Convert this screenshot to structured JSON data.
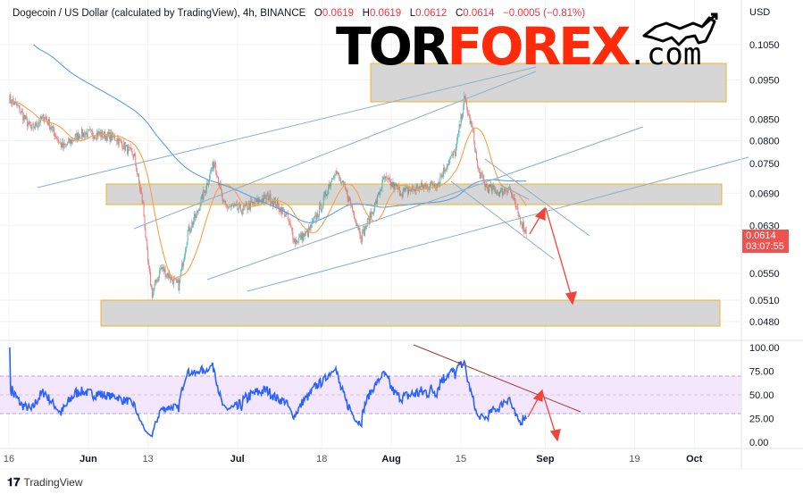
{
  "header": {
    "symbol": "Dogecoin / US Dollar (calculated by TradingView), 4h, BINANCE",
    "o_label": "O",
    "o_value": "0.0619",
    "h_label": "H",
    "h_value": "0.0619",
    "l_label": "L",
    "l_value": "0.0612",
    "c_label": "C",
    "c_value": "0.0614",
    "change": "−0.0005 (−0.81%)"
  },
  "watermark": {
    "part1": "TOR",
    "part2": "FOREX",
    "part3": ".com"
  },
  "price_tag": {
    "price": "0.0614",
    "countdown": "03:07:55"
  },
  "footer": {
    "brand": "TradingView"
  },
  "colors": {
    "up": "#26a69a",
    "down": "#ef5350",
    "ma_fast": "#f7a24a",
    "ma_slow": "#5b9cf0",
    "rsi": "#2962ff",
    "zone_border": "#f0b429",
    "arrow": "#f0443a",
    "accent_red": "#ff2a0a"
  },
  "chart_data": {
    "type": "candlestick",
    "title": "Dogecoin / US Dollar, 4h, BINANCE",
    "currency_label": "USD",
    "y_scale": "log",
    "ylim": [
      0.0455,
      0.112
    ],
    "y_ticks": [
      "0.1050",
      "0.0950",
      "0.0850",
      "0.0800",
      "0.0750",
      "0.0690",
      "0.0630",
      "0.0550",
      "0.0510",
      "0.0480"
    ],
    "x_ticks": [
      {
        "label": "16",
        "day": 0,
        "bold": false
      },
      {
        "label": "Jun",
        "day": 16,
        "bold": true
      },
      {
        "label": "13",
        "day": 28,
        "bold": false
      },
      {
        "label": "Jul",
        "day": 46,
        "bold": true
      },
      {
        "label": "18",
        "day": 63,
        "bold": false
      },
      {
        "label": "Aug",
        "day": 77,
        "bold": true
      },
      {
        "label": "15",
        "day": 91,
        "bold": false
      },
      {
        "label": "Sep",
        "day": 108,
        "bold": true
      },
      {
        "label": "19",
        "day": 126,
        "bold": false
      },
      {
        "label": "Oct",
        "day": 138,
        "bold": true
      }
    ],
    "x_unit": "days since May 16",
    "close_path": [
      [
        0,
        0.0902
      ],
      [
        1.8,
        0.088
      ],
      [
        4.5,
        0.0826
      ],
      [
        7.2,
        0.0858
      ],
      [
        10.8,
        0.0785
      ],
      [
        14.4,
        0.0816
      ],
      [
        18,
        0.0816
      ],
      [
        21.6,
        0.0806
      ],
      [
        25.2,
        0.0766
      ],
      [
        27,
        0.0667
      ],
      [
        27.9,
        0.0573
      ],
      [
        28.8,
        0.0518
      ],
      [
        30.6,
        0.0559
      ],
      [
        32.4,
        0.0545
      ],
      [
        34.2,
        0.0531
      ],
      [
        36,
        0.0618
      ],
      [
        37.8,
        0.065
      ],
      [
        41.4,
        0.0756
      ],
      [
        43.2,
        0.0667
      ],
      [
        46.8,
        0.0658
      ],
      [
        52.2,
        0.0684
      ],
      [
        55.8,
        0.065
      ],
      [
        57.6,
        0.0602
      ],
      [
        60.3,
        0.0618
      ],
      [
        63,
        0.0667
      ],
      [
        65.6,
        0.0737
      ],
      [
        68.3,
        0.0684
      ],
      [
        71,
        0.061
      ],
      [
        73.7,
        0.0667
      ],
      [
        75.5,
        0.0719
      ],
      [
        79.1,
        0.0692
      ],
      [
        82.7,
        0.0701
      ],
      [
        86.3,
        0.071
      ],
      [
        88.1,
        0.0747
      ],
      [
        89.9,
        0.0776
      ],
      [
        91.7,
        0.0902
      ],
      [
        93.5,
        0.0816
      ],
      [
        94.4,
        0.0737
      ],
      [
        96.2,
        0.0701
      ],
      [
        98.9,
        0.0692
      ],
      [
        100.7,
        0.0701
      ],
      [
        102.5,
        0.065
      ],
      [
        104.3,
        0.0614
      ]
    ],
    "last_close": 0.0614,
    "indicators": [
      "MA fast (orange)",
      "MA slow (blue)"
    ],
    "rsi": {
      "y_ticks": [
        "100.00",
        "75.00",
        "50.00",
        "25.00",
        "0.00"
      ],
      "ylim": [
        0,
        100
      ],
      "band": [
        30,
        70
      ],
      "period": 14
    }
  }
}
